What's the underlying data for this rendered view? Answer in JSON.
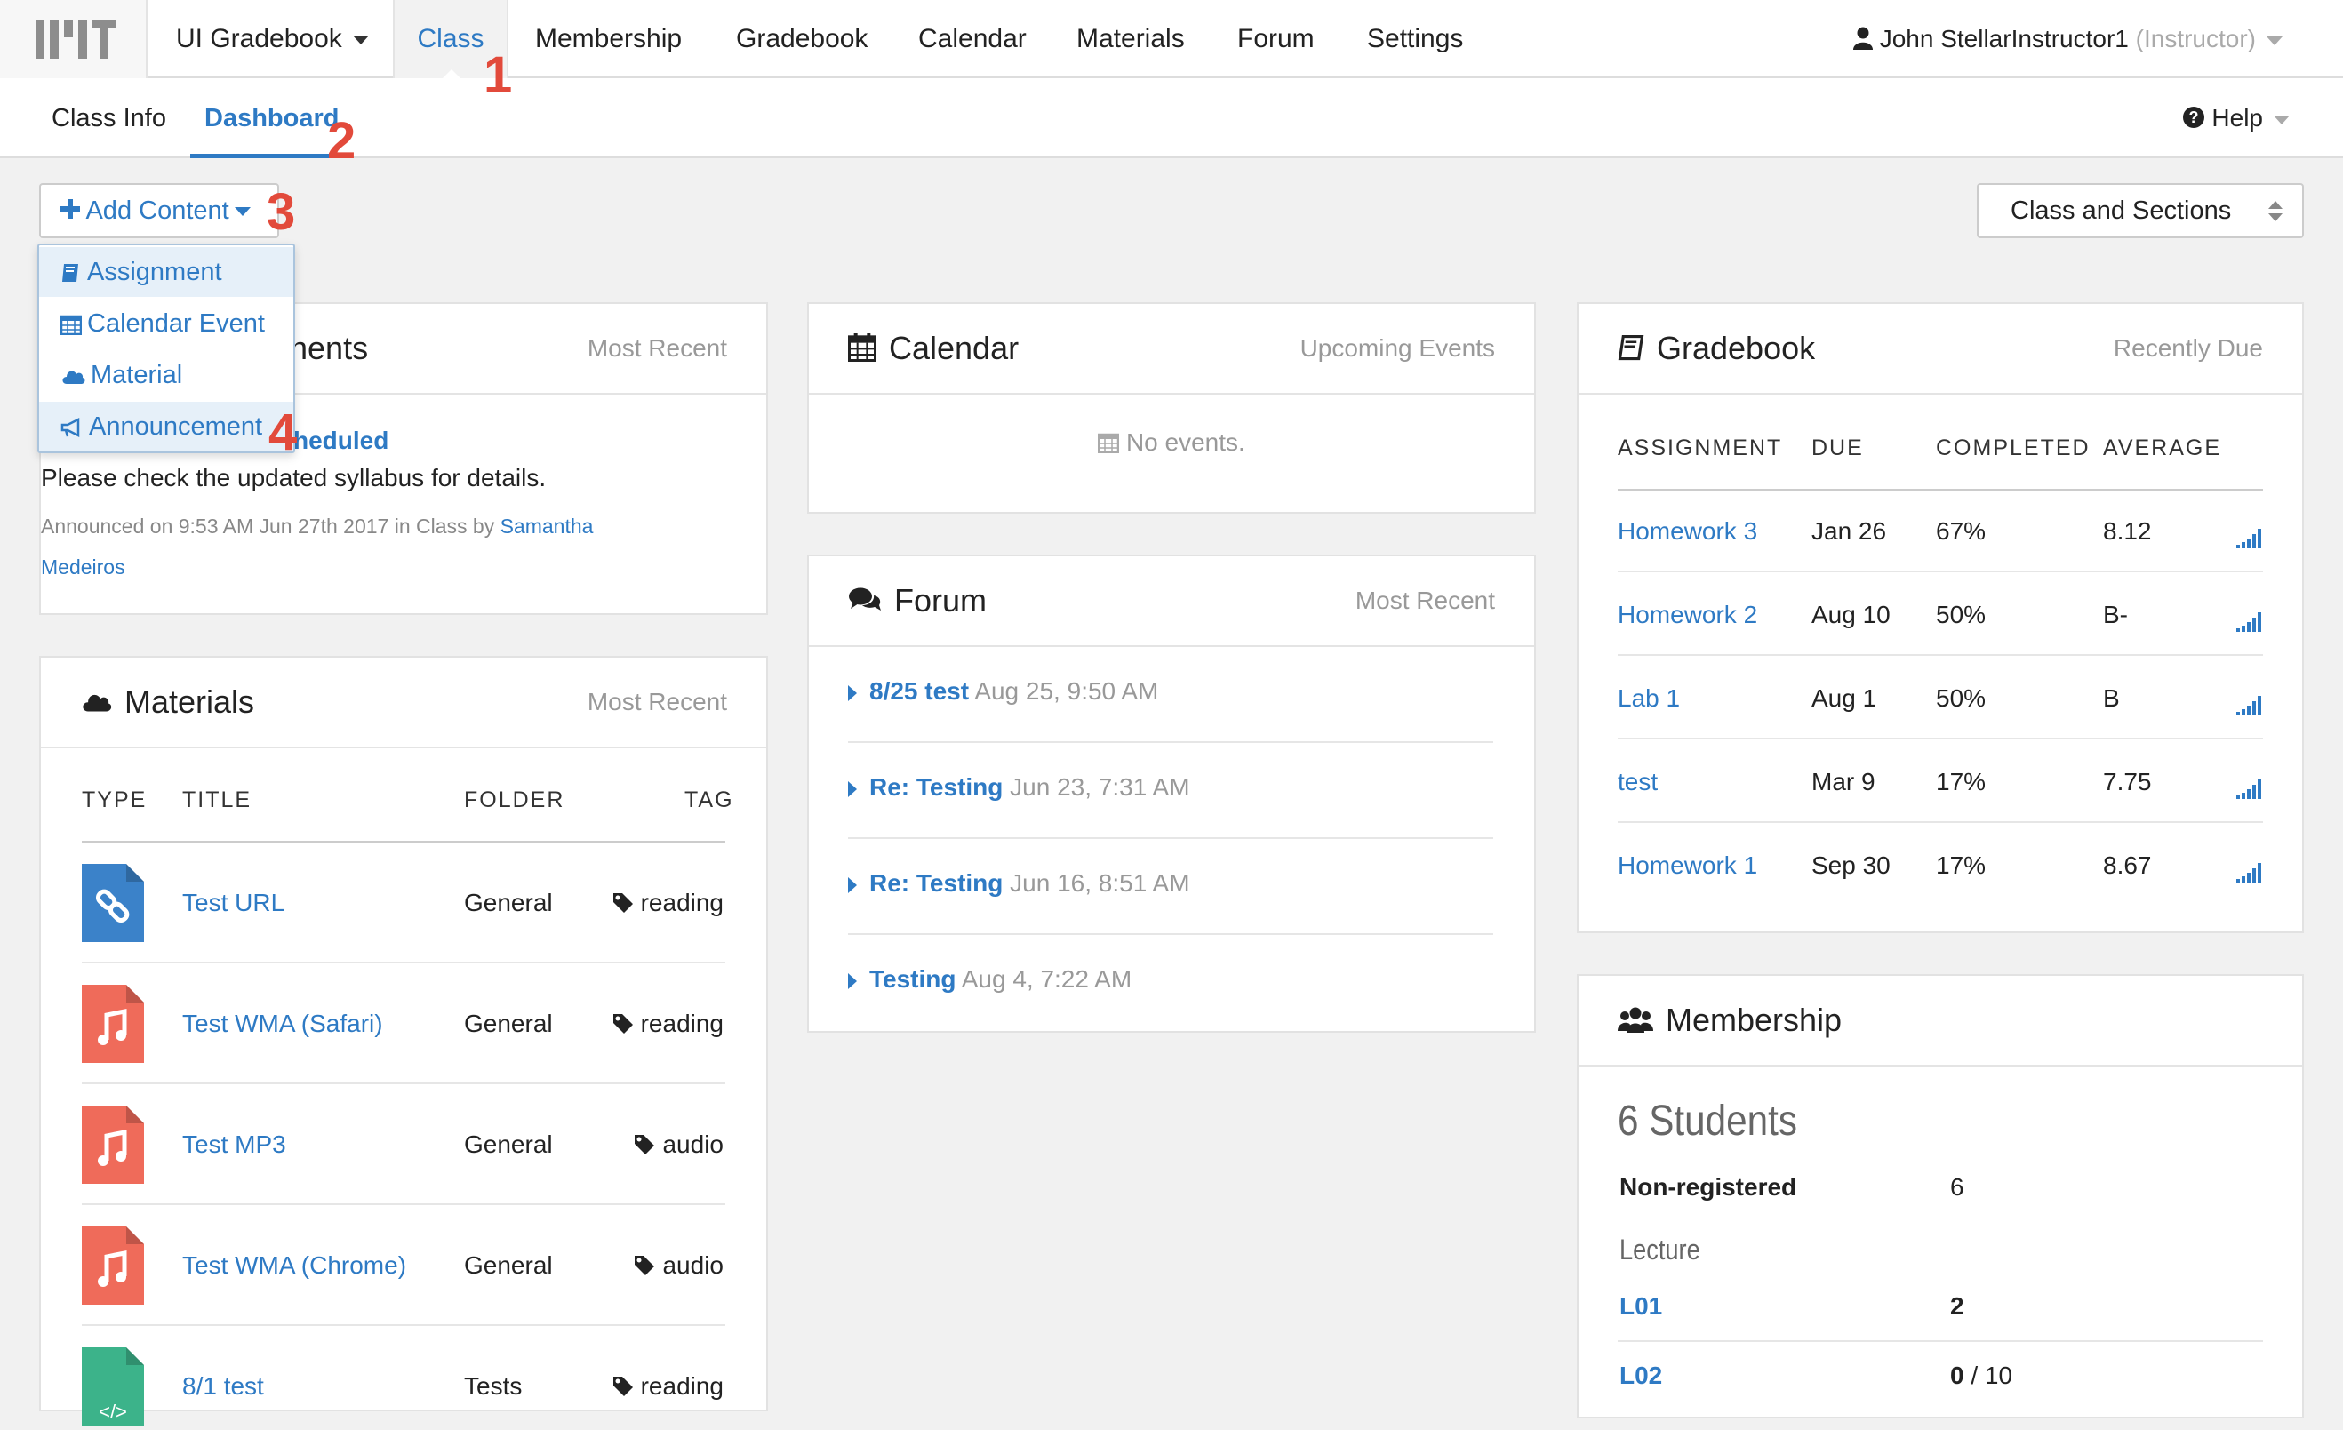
{
  "topnav": {
    "course": "UI Gradebook",
    "items": [
      "Class",
      "Membership",
      "Gradebook",
      "Calendar",
      "Materials",
      "Forum",
      "Settings"
    ],
    "user": "John StellarInstructor1",
    "role": "(Instructor)"
  },
  "subnav": {
    "items": [
      "Class Info",
      "Dashboard"
    ],
    "help": "Help"
  },
  "toolbar": {
    "add_content": "Add Content",
    "class_select": "Class and Sections"
  },
  "dropdown": {
    "items": [
      "Assignment",
      "Calendar Event",
      "Material",
      "Announcement"
    ]
  },
  "steps": [
    "1",
    "2",
    "3",
    "4"
  ],
  "announcements": {
    "title_visible": "nents",
    "hint": "Most Recent",
    "link_visible": "heduled",
    "body": "Please check the updated syllabus for details.",
    "meta_prefix": "Announced on 9:53 AM Jun 27th 2017 in Class by ",
    "author_first": "Samantha",
    "author_last": "Medeiros"
  },
  "materials": {
    "title": "Materials",
    "hint": "Most Recent",
    "headers": [
      "TYPE",
      "TITLE",
      "FOLDER",
      "TAG"
    ],
    "rows": [
      {
        "icon": "link-file-icon",
        "title": "Test URL",
        "folder": "General",
        "tag": "reading"
      },
      {
        "icon": "music-file-icon",
        "title": "Test WMA (Safari)",
        "folder": "General",
        "tag": "reading"
      },
      {
        "icon": "music-file-icon",
        "title": "Test MP3",
        "folder": "General",
        "tag": "audio"
      },
      {
        "icon": "music-file-icon",
        "title": "Test WMA (Chrome)",
        "folder": "General",
        "tag": "audio"
      },
      {
        "icon": "code-file-icon",
        "title": "8/1 test",
        "folder": "Tests",
        "tag": "reading"
      }
    ]
  },
  "calendar": {
    "title": "Calendar",
    "hint": "Upcoming Events",
    "empty": "No events."
  },
  "forum": {
    "title": "Forum",
    "hint": "Most Recent",
    "items": [
      {
        "title": "8/25 test",
        "date": "Aug 25, 9:50 AM"
      },
      {
        "title": "Re: Testing",
        "date": "Jun 23, 7:31 AM"
      },
      {
        "title": "Re: Testing",
        "date": "Jun 16, 8:51 AM"
      },
      {
        "title": "Testing",
        "date": "Aug 4, 7:22 AM"
      }
    ]
  },
  "gradebook": {
    "title": "Gradebook",
    "hint": "Recently Due",
    "headers": [
      "ASSIGNMENT",
      "DUE",
      "COMPLETED",
      "AVERAGE"
    ],
    "rows": [
      {
        "name": "Homework 3",
        "due": "Jan 26",
        "completed": "67%",
        "average": "8.12"
      },
      {
        "name": "Homework 2",
        "due": "Aug 10",
        "completed": "50%",
        "average": "B-"
      },
      {
        "name": "Lab 1",
        "due": "Aug 1",
        "completed": "50%",
        "average": "B"
      },
      {
        "name": "test",
        "due": "Mar 9",
        "completed": "17%",
        "average": "7.75"
      },
      {
        "name": "Homework 1",
        "due": "Sep 30",
        "completed": "17%",
        "average": "8.67"
      }
    ]
  },
  "membership": {
    "title": "Membership",
    "count": "6 Students",
    "nonreg_label": "Non-registered",
    "nonreg_value": "6",
    "lecture_label": "Lecture",
    "sections": [
      {
        "name": "L01",
        "value": "2",
        "extra": ""
      },
      {
        "name": "L02",
        "value": "0",
        "extra": " / 10"
      }
    ]
  },
  "colors": {
    "accent": "#2e7ac4",
    "marker": "#e24a3b",
    "music_icon": "#ef6b5a",
    "link_icon": "#3b82c9",
    "code_icon": "#3cb38a"
  }
}
